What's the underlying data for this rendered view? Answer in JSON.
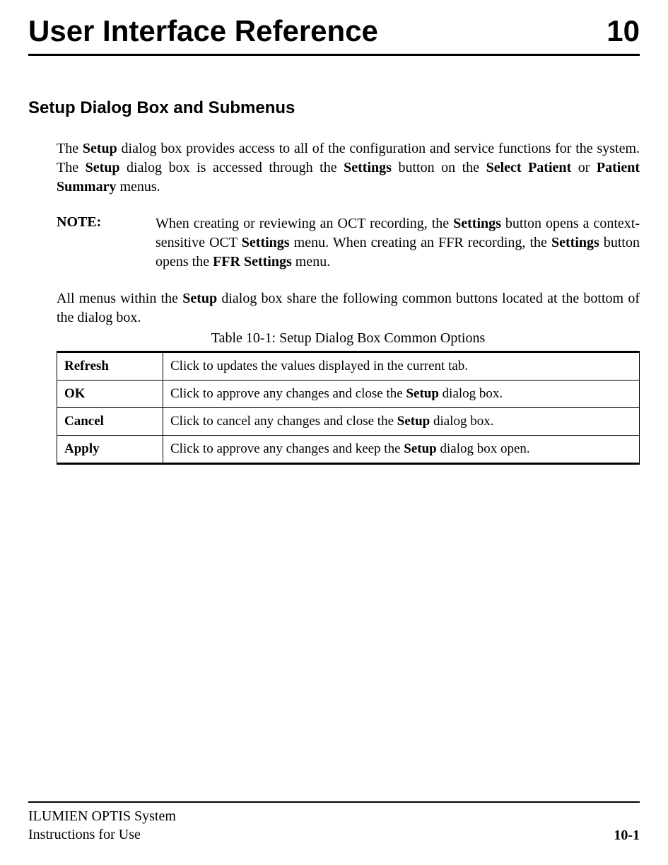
{
  "chapter": {
    "title": "User Interface Reference",
    "number": "10"
  },
  "section": {
    "heading": "Setup Dialog Box and Submenus",
    "para1_html": "The <b>Setup</b> dialog box provides access to all of the configuration and service functions for the system. The <b>Setup</b> dialog box is accessed through the <b>Settings</b> button on the <b>Select Patient</b> or <b>Patient Summary</b> menus.",
    "note_label": "NOTE:",
    "note_html": "When creating or reviewing an OCT recording, the <b>Settings</b> button opens a context-sensitive OCT <b>Settings</b> menu. When creating an FFR recording, the <b>Settings</b> button opens the <b>FFR Settings</b> menu.",
    "para2_html": "All menus within the <b>Setup</b> dialog box share the following common buttons located at the bottom of the dialog box."
  },
  "table": {
    "caption": "Table 10-1:  Setup Dialog Box Common Options",
    "rows": [
      {
        "label": "Refresh",
        "desc_html": "Click to updates the values displayed in the current tab."
      },
      {
        "label": "OK",
        "desc_html": "Click to approve any changes and close the <b>Setup</b> dialog box."
      },
      {
        "label": "Cancel",
        "desc_html": "Click to cancel any changes and close the <b>Setup</b> dialog box."
      },
      {
        "label": "Apply",
        "desc_html": "Click to approve any changes and keep the <b>Setup</b> dialog box open."
      }
    ]
  },
  "footer": {
    "line1_html": "I<span class=\"footer-smallcaps\">LUMIEN</span> O<span class=\"footer-smallcaps\">PTIS</span> System",
    "line2": "Instructions for Use",
    "page": "10-1"
  }
}
